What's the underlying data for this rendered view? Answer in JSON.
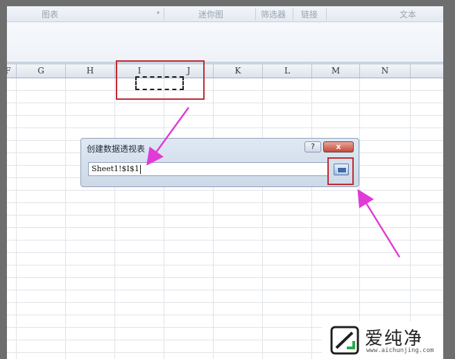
{
  "ribbon": {
    "groups": [
      "图表",
      "迷你图",
      "筛选器",
      "链接",
      "文本"
    ]
  },
  "columns": [
    "F",
    "G",
    "H",
    "I",
    "J",
    "K",
    "L",
    "M",
    "N"
  ],
  "dialog": {
    "title": "创建数据透视表",
    "help_label": "?",
    "close_label": "x",
    "reference_value": "Sheet1!$I$1"
  },
  "watermark": {
    "name": "爱纯净",
    "url": "www.aichunjing.com"
  },
  "colors": {
    "annotation_box": "#c0272d",
    "arrow": "#e03bd6"
  }
}
